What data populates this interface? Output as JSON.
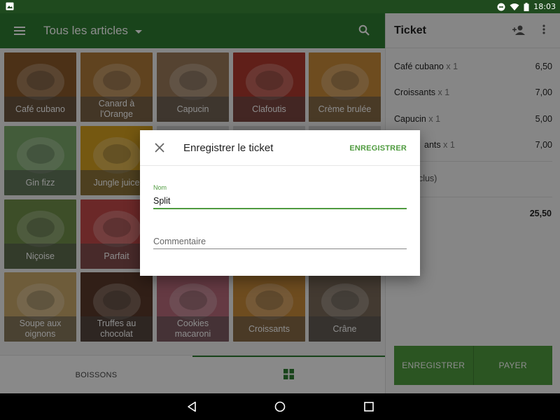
{
  "status_bar": {
    "time": "18:03"
  },
  "app_bar": {
    "title": "Tous les articles"
  },
  "products": [
    {
      "name": "Café cubano",
      "color": "#8b5a2b"
    },
    {
      "name": "Canard à l'Orange",
      "color": "#b07a3a"
    },
    {
      "name": "Capucin",
      "color": "#9c7a5a"
    },
    {
      "name": "Clafoutis",
      "color": "#b03a2e"
    },
    {
      "name": "Crème brulée",
      "color": "#c88a3a"
    },
    {
      "name": "Gin fizz",
      "color": "#7aa86a"
    },
    {
      "name": "Jungle juice",
      "color": "#d6a020"
    },
    {
      "name": "",
      "color": "#cfcfcf"
    },
    {
      "name": "",
      "color": "#cfcfcf"
    },
    {
      "name": "",
      "color": "#cfcfcf"
    },
    {
      "name": "Niçoise",
      "color": "#6f8f4a"
    },
    {
      "name": "Parfait",
      "color": "#c44a4a"
    },
    {
      "name": "",
      "color": "#cfcfcf"
    },
    {
      "name": "",
      "color": "#cfcfcf"
    },
    {
      "name": "",
      "color": "#cfcfcf"
    },
    {
      "name": "Soupe aux oignons",
      "color": "#c9a86a"
    },
    {
      "name": "Truffes au chocolat",
      "color": "#5a3a2a"
    },
    {
      "name": "Cookies macaroni",
      "color": "#b86a7a"
    },
    {
      "name": "Croissants",
      "color": "#c98a3a"
    },
    {
      "name": "Crâne",
      "color": "#7a6a5a"
    }
  ],
  "bottom_tabs": {
    "drinks_label": "BOISSONS"
  },
  "ticket": {
    "title": "Ticket",
    "items": [
      {
        "name": "Café cubano",
        "qty": "x 1",
        "price": "6,50"
      },
      {
        "name": "Croissants",
        "qty": "x 1",
        "price": "7,00"
      },
      {
        "name": "Capucin",
        "qty": "x 1",
        "price": "5,00"
      },
      {
        "name": "ants",
        "qty": "x 1",
        "price": "7,00"
      }
    ],
    "tax_note": "nclus)",
    "total": "25,50",
    "save_label": "ENREGISTRER",
    "pay_label": "PAYER"
  },
  "dialog": {
    "title": "Enregistrer le ticket",
    "save_label": "ENREGISTRER",
    "name_label": "Nom",
    "name_value": "Split",
    "comment_placeholder": "Commentaire"
  },
  "colors": {
    "primary": "#2e7d32",
    "accent": "#4f9b3f"
  }
}
